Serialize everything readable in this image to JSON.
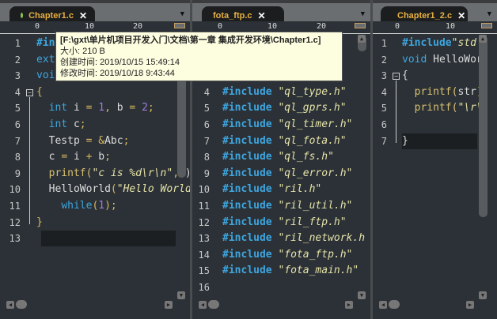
{
  "panes": [
    {
      "tab": {
        "label": "Chapter1.c",
        "close": "✕",
        "indicator": "#8bc34a"
      },
      "ruler": [
        "0",
        "10",
        "20"
      ],
      "lines": [
        [
          {
            "k": "keyword",
            "t": "#in"
          }
        ],
        [
          {
            "k": "type",
            "t": "ext"
          }
        ],
        [
          {
            "k": "type",
            "t": "voi"
          }
        ],
        [
          {
            "k": "op",
            "t": "{"
          }
        ],
        [
          {
            "k": "plain",
            "t": "  "
          },
          {
            "k": "type",
            "t": "int"
          },
          {
            "k": "plain",
            "t": " i "
          },
          {
            "k": "op",
            "t": "="
          },
          {
            "k": "plain",
            "t": " "
          },
          {
            "k": "number",
            "t": "1"
          },
          {
            "k": "op",
            "t": ","
          },
          {
            "k": "plain",
            "t": " b "
          },
          {
            "k": "op",
            "t": "="
          },
          {
            "k": "plain",
            "t": " "
          },
          {
            "k": "number",
            "t": "2"
          },
          {
            "k": "op",
            "t": ";"
          }
        ],
        [
          {
            "k": "plain",
            "t": "  "
          },
          {
            "k": "type",
            "t": "int"
          },
          {
            "k": "plain",
            "t": " c"
          },
          {
            "k": "op",
            "t": ";"
          }
        ],
        [
          {
            "k": "plain",
            "t": "  Testp "
          },
          {
            "k": "op",
            "t": "= &"
          },
          {
            "k": "plain",
            "t": "Abc"
          },
          {
            "k": "op",
            "t": ";"
          }
        ],
        [
          {
            "k": "plain",
            "t": "  c "
          },
          {
            "k": "op",
            "t": "="
          },
          {
            "k": "plain",
            "t": " i "
          },
          {
            "k": "op",
            "t": "+"
          },
          {
            "k": "plain",
            "t": " b"
          },
          {
            "k": "op",
            "t": ";"
          }
        ],
        [
          {
            "k": "plain",
            "t": "  "
          },
          {
            "k": "func",
            "t": "printf("
          },
          {
            "k": "string",
            "t": "\"c is %d\\r\\n\""
          },
          {
            "k": "op",
            "t": ","
          },
          {
            "k": "plain",
            "t": "c)"
          }
        ],
        [
          {
            "k": "plain",
            "t": "  HelloWorld"
          },
          {
            "k": "op",
            "t": "("
          },
          {
            "k": "string",
            "t": "\"Hello World"
          }
        ],
        [
          {
            "k": "plain",
            "t": "    "
          },
          {
            "k": "type",
            "t": "while"
          },
          {
            "k": "op",
            "t": "("
          },
          {
            "k": "number",
            "t": "1"
          },
          {
            "k": "op",
            "t": ");"
          }
        ],
        [
          {
            "k": "op",
            "t": "}"
          }
        ],
        []
      ]
    },
    {
      "tab": {
        "label": "fota_ftp.c",
        "close": "✕"
      },
      "ruler": [
        "0",
        "10",
        "20"
      ],
      "lines": [
        [
          {
            "k": "string",
            "t": "r"
          }
        ],
        [],
        [],
        [
          {
            "k": "keyword",
            "t": "#include"
          },
          {
            "k": "plain",
            "t": " "
          },
          {
            "k": "string",
            "t": "\"ql_type.h\""
          }
        ],
        [
          {
            "k": "keyword",
            "t": "#include"
          },
          {
            "k": "plain",
            "t": " "
          },
          {
            "k": "string",
            "t": "\"ql_gprs.h\""
          }
        ],
        [
          {
            "k": "keyword",
            "t": "#include"
          },
          {
            "k": "plain",
            "t": " "
          },
          {
            "k": "string",
            "t": "\"ql_timer.h\""
          }
        ],
        [
          {
            "k": "keyword",
            "t": "#include"
          },
          {
            "k": "plain",
            "t": " "
          },
          {
            "k": "string",
            "t": "\"ql_fota.h\""
          }
        ],
        [
          {
            "k": "keyword",
            "t": "#include"
          },
          {
            "k": "plain",
            "t": " "
          },
          {
            "k": "string",
            "t": "\"ql_fs.h\""
          }
        ],
        [
          {
            "k": "keyword",
            "t": "#include"
          },
          {
            "k": "plain",
            "t": " "
          },
          {
            "k": "string",
            "t": "\"ql_error.h\""
          }
        ],
        [
          {
            "k": "keyword",
            "t": "#include"
          },
          {
            "k": "plain",
            "t": " "
          },
          {
            "k": "string",
            "t": "\"ril.h\""
          }
        ],
        [
          {
            "k": "keyword",
            "t": "#include"
          },
          {
            "k": "plain",
            "t": " "
          },
          {
            "k": "string",
            "t": "\"ril_util.h\""
          }
        ],
        [
          {
            "k": "keyword",
            "t": "#include"
          },
          {
            "k": "plain",
            "t": " "
          },
          {
            "k": "string",
            "t": "\"ril_ftp.h\""
          }
        ],
        [
          {
            "k": "keyword",
            "t": "#include"
          },
          {
            "k": "plain",
            "t": " "
          },
          {
            "k": "string",
            "t": "\"ril_network.h"
          }
        ],
        [
          {
            "k": "keyword",
            "t": "#include"
          },
          {
            "k": "plain",
            "t": " "
          },
          {
            "k": "string",
            "t": "\"fota_ftp.h\""
          }
        ],
        [
          {
            "k": "keyword",
            "t": "#include"
          },
          {
            "k": "plain",
            "t": " "
          },
          {
            "k": "string",
            "t": "\"fota_main.h\""
          }
        ],
        []
      ]
    },
    {
      "tab": {
        "label": "Chapter1_2.c",
        "close": "✕",
        "indicator": "#e53935"
      },
      "ruler": [
        "0",
        "10"
      ],
      "lines": [
        [
          {
            "k": "keyword",
            "t": "#include"
          },
          {
            "k": "string",
            "t": "\"std"
          }
        ],
        [
          {
            "k": "type",
            "t": "void"
          },
          {
            "k": "plain",
            "t": " HelloWor"
          }
        ],
        [
          {
            "k": "plain",
            "t": "{"
          }
        ],
        [
          {
            "k": "plain",
            "t": "  "
          },
          {
            "k": "func",
            "t": "printf("
          },
          {
            "k": "plain",
            "t": "str"
          },
          {
            "k": "op",
            "t": ");"
          }
        ],
        [
          {
            "k": "plain",
            "t": "  "
          },
          {
            "k": "func",
            "t": "printf("
          },
          {
            "k": "string",
            "t": "\"\\r\\"
          }
        ],
        [],
        [
          {
            "k": "plain",
            "t": "}"
          }
        ]
      ]
    }
  ],
  "tooltip": {
    "path": "[F:\\gxt\\单片机项目开发入门\\文档\\第一章 集成开发环境\\Chapter1.c]",
    "size": "大小: 210 B",
    "created": "创建时间: 2019/10/15 15:49:14",
    "modified": "修改时间: 2019/10/18 9:43:44"
  }
}
